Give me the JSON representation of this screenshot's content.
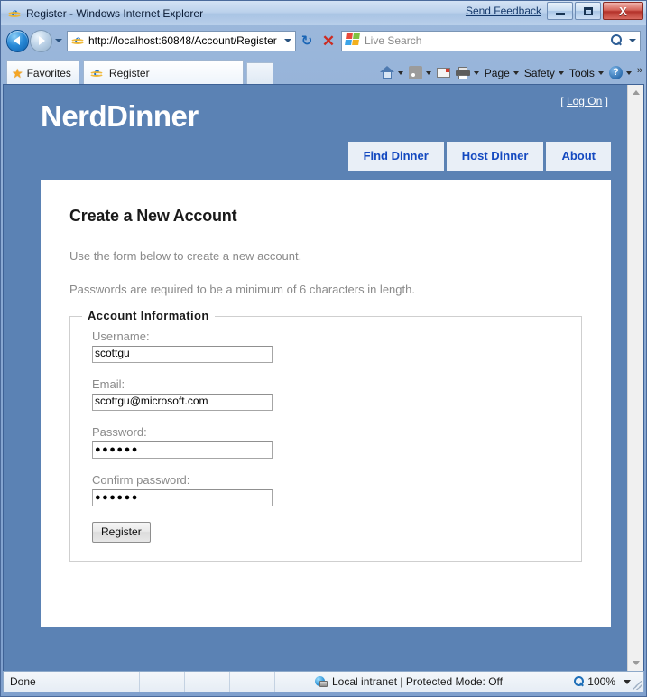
{
  "window": {
    "title": "Register - Windows Internet Explorer",
    "send_feedback": "Send Feedback",
    "minimize": "Minimize",
    "maximize": "Maximize",
    "close": "X"
  },
  "nav": {
    "back": "Back",
    "forward": "Forward",
    "history_dropdown": "Recent Pages",
    "address_value": "http://localhost:60848/Account/Register",
    "address_dropdown": "Address dropdown",
    "refresh": "↻",
    "stop": "✕",
    "search_placeholder": "Live Search",
    "search_value": ""
  },
  "tabbar": {
    "favorites_label": "Favorites",
    "tab_label": "Register",
    "new_tab_label": "",
    "commands": [
      {
        "name": "home",
        "label": "",
        "caret": true
      },
      {
        "name": "feeds",
        "label": "",
        "caret": true
      },
      {
        "name": "read-mail",
        "label": "",
        "caret": false
      },
      {
        "name": "print",
        "label": "",
        "caret": true
      },
      {
        "name": "page",
        "label": "Page",
        "caret": true
      },
      {
        "name": "safety",
        "label": "Safety",
        "caret": true
      },
      {
        "name": "tools",
        "label": "Tools",
        "caret": true
      },
      {
        "name": "help",
        "label": "",
        "caret": true
      }
    ],
    "overflow": "»"
  },
  "site": {
    "logo": "NerdDinner",
    "login_prefix": "[",
    "login_label": "Log On",
    "login_suffix": "]",
    "nav_tabs": [
      {
        "label": "Find Dinner"
      },
      {
        "label": "Host Dinner"
      },
      {
        "label": "About"
      }
    ],
    "accent_blue": "#5b82b4",
    "tab_bg": "#e9eff7",
    "tab_text": "#1449c0"
  },
  "page": {
    "heading": "Create a New Account",
    "intro": "Use the form below to create a new account.",
    "password_note": "Passwords are required to be a minimum of 6 characters in length.",
    "fieldset_legend": "Account Information",
    "fields": [
      {
        "name": "username",
        "label": "Username:",
        "value": "scottgu",
        "type": "text"
      },
      {
        "name": "email",
        "label": "Email:",
        "value": "scottgu@microsoft.com",
        "type": "text"
      },
      {
        "name": "password",
        "label": "Password:",
        "value": "●●●●●●",
        "type": "password"
      },
      {
        "name": "confirm-password",
        "label": "Confirm password:",
        "value": "●●●●●●",
        "type": "password"
      }
    ],
    "submit_label": "Register"
  },
  "status": {
    "message": "Done",
    "zone": "Local intranet | Protected Mode: Off",
    "zoom_level": "100%"
  }
}
